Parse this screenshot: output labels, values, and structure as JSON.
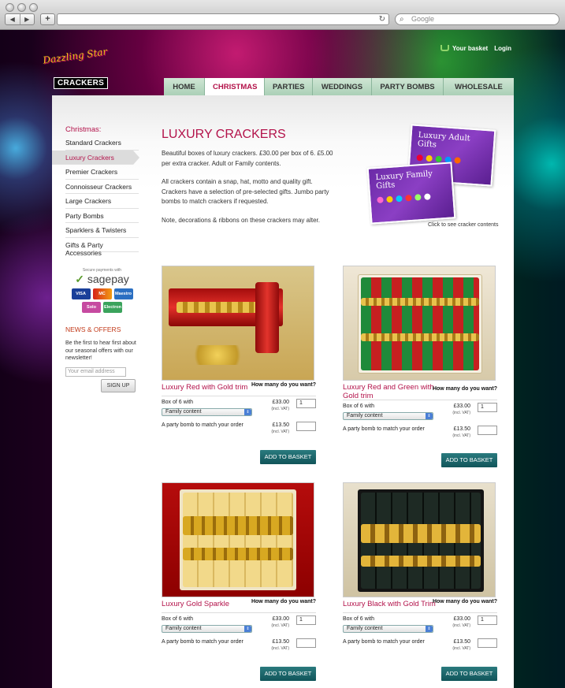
{
  "browser": {
    "search_placeholder": "Google"
  },
  "header": {
    "logo_script": "Dazzling Star",
    "logo_text": "CRACKERS",
    "basket_label": "Your basket",
    "login_label": "Login"
  },
  "tabs": [
    {
      "label": "HOME"
    },
    {
      "label": "CHRISTMAS"
    },
    {
      "label": "PARTIES"
    },
    {
      "label": "WEDDINGS"
    },
    {
      "label": "PARTY BOMBS"
    },
    {
      "label": "WHOLESALE"
    }
  ],
  "sidebar": {
    "heading": "Christmas:",
    "items": [
      {
        "label": "Standard Crackers"
      },
      {
        "label": "Luxury Crackers"
      },
      {
        "label": "Premier Crackers"
      },
      {
        "label": "Connoisseur Crackers"
      },
      {
        "label": "Large Crackers"
      },
      {
        "label": "Party Bombs"
      },
      {
        "label": "Sparklers & Twisters"
      },
      {
        "label": "Gifts & Party Accessories"
      }
    ],
    "payments_title": "Secure payments with",
    "payments_brand": "sagepay",
    "cards": [
      "VISA",
      "MC",
      "Maestro",
      "Solo",
      "Electron"
    ],
    "news_title": "NEWS & OFFERS",
    "news_text": "Be the first to hear first about our seasonal offers with our newsletter!",
    "email_placeholder": "Your email address",
    "signup_label": "SIGN UP"
  },
  "intro": {
    "title": "LUXURY CRACKERS",
    "p1": "Beautiful boxes of luxury crackers.  £30.00 per box of 6. £5.00 per extra cracker. Adult or Family contents.",
    "p2": "All crackers contain a snap, hat, motto and quality gift. Crackers have a selection of pre-selected gifts. Jumbo party bombs to match crackers if requested.",
    "p3": "Note, decorations & ribbons on these crackers may alter.",
    "gift_adult": "Luxury Adult Gifts",
    "gift_family": "Luxury Family Gifts",
    "gift_caption": "Click to see cracker contents"
  },
  "products_common": {
    "howmany": "How many do you want?",
    "box_label": "Box of 6 with",
    "bomb_label": "A party bomb to match your order",
    "vat": "(incl. VAT)",
    "add_label": "ADD TO BASKET"
  },
  "products": [
    {
      "name": "Luxury Red with Gold trim",
      "box_price": "£33.00",
      "select_value": "Family content",
      "qty": "1",
      "bomb_price": "£13.50",
      "bomb_qty": ""
    },
    {
      "name": "Luxury Red and Green with Gold trim",
      "box_price": "£33.00",
      "select_value": "Family content",
      "qty": "1",
      "bomb_price": "£13.50",
      "bomb_qty": ""
    },
    {
      "name": "Luxury Gold Sparkle",
      "box_price": "£33.00",
      "select_value": "Family content",
      "qty": "1",
      "bomb_price": "£13.50",
      "bomb_qty": ""
    },
    {
      "name": "Luxury Black with Gold Trim",
      "box_price": "£33.00",
      "select_value": "Family content",
      "qty": "1",
      "bomb_price": "£13.50",
      "bomb_qty": ""
    }
  ],
  "colors": {
    "accent": "#b3124a",
    "button": "#1c6a6e",
    "tab_bg": "#b9dac3"
  }
}
